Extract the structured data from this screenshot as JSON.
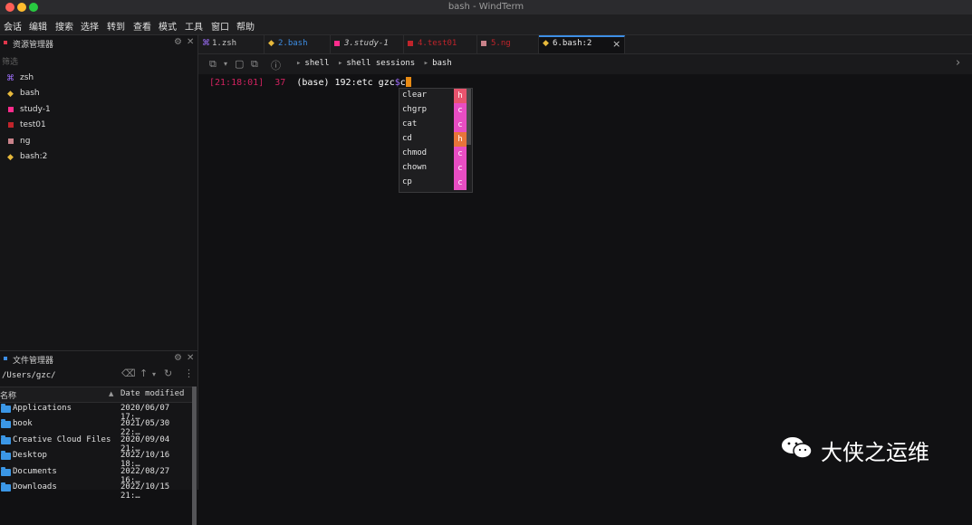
{
  "window": {
    "title": "bash - WindTerm"
  },
  "colors": {
    "traffic_close": "#fe5f57",
    "traffic_min": "#febc2e",
    "traffic_max": "#28c840",
    "accent": "#3d8ee5",
    "timestamp": "#d0225f",
    "cursor": "#e88b14",
    "badge_h_1": "#e8546e",
    "badge_h_2": "#e7743a",
    "badge_c": "#e84dc3"
  },
  "menu": [
    "会话",
    "编辑",
    "搜索",
    "选择",
    "转到",
    "查看",
    "模式",
    "工具",
    "窗口",
    "帮助"
  ],
  "explorer": {
    "title": "资源管理器",
    "filter_placeholder": "筛选",
    "items": [
      {
        "label": "zsh",
        "icon": "command-icon",
        "color": "#a070ff"
      },
      {
        "label": "bash",
        "icon": "diamond-icon",
        "color": "#e7b93c"
      },
      {
        "label": "study-1",
        "icon": "square-icon",
        "color": "#ff2c8c"
      },
      {
        "label": "test01",
        "icon": "square-icon",
        "color": "#c0242b"
      },
      {
        "label": "ng",
        "icon": "square-icon",
        "color": "#c9828a"
      },
      {
        "label": "bash:2",
        "icon": "diamond-icon",
        "color": "#e7b93c"
      }
    ]
  },
  "file_manager": {
    "title": "文件管理器",
    "path": "/Users/gzc/",
    "col_name": "名称",
    "col_date": "Date modified",
    "rows": [
      {
        "name": "Applications",
        "date": "2020/06/07 17:…"
      },
      {
        "name": "book",
        "date": "2021/05/30 22:…"
      },
      {
        "name": "Creative Cloud Files",
        "date": "2020/09/04 21:…"
      },
      {
        "name": "Desktop",
        "date": "2022/10/16 18:…"
      },
      {
        "name": "Documents",
        "date": "2022/08/27 16:…"
      },
      {
        "name": "Downloads",
        "date": "2022/10/15 21:…"
      }
    ]
  },
  "tabs": [
    {
      "label": "1.zsh",
      "color": "#c8c8c8",
      "icon_color": "#a070ff",
      "icon": "command-icon"
    },
    {
      "label": "2.bash",
      "color": "#3d8ee5",
      "icon_color": "#e7b93c",
      "icon": "diamond-icon"
    },
    {
      "label": "3.study-1",
      "color": "#c8c8c8",
      "icon_color": "#ff2c8c",
      "icon": "square-icon"
    },
    {
      "label": "4.test01",
      "color": "#c0242b",
      "icon_color": "#c0242b",
      "icon": "square-icon"
    },
    {
      "label": "5.ng",
      "color": "#c0242b",
      "icon_color": "#c9828a",
      "icon": "square-icon"
    },
    {
      "label": "6.bash:2",
      "color": "#e8e8e8",
      "icon_color": "#e7b93c",
      "icon": "diamond-icon"
    }
  ],
  "tab_close": "×",
  "breadcrumb": [
    "shell",
    "shell sessions",
    "bash"
  ],
  "terminal": {
    "timestamp": "[21:18:01]",
    "line_no": "37",
    "prompt": "(base) 192:etc gzc",
    "dollar": "$",
    "input": "c"
  },
  "autocomplete": [
    {
      "label": "clear",
      "badge": "h"
    },
    {
      "label": "chgrp",
      "badge": "c"
    },
    {
      "label": "cat",
      "badge": "c"
    },
    {
      "label": "cd",
      "badge": "h"
    },
    {
      "label": "chmod",
      "badge": "c"
    },
    {
      "label": "chown",
      "badge": "c"
    },
    {
      "label": "cp",
      "badge": "c"
    }
  ],
  "watermark": {
    "text": "大侠之运维"
  }
}
